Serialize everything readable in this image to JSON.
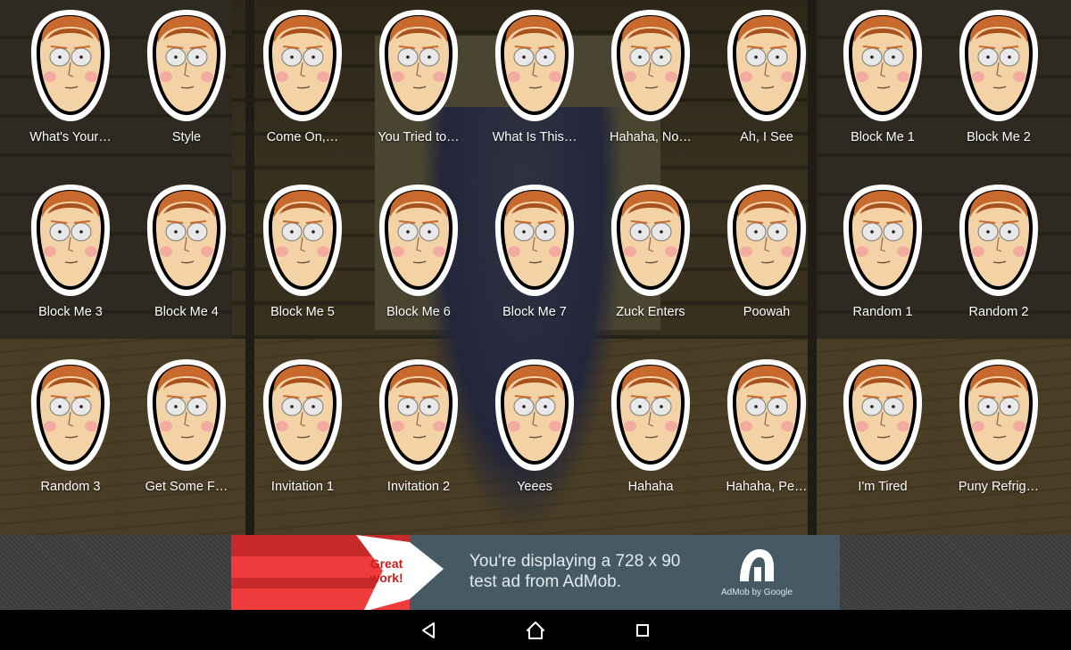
{
  "sounds": [
    "What's Your…",
    "Style",
    "Come On,…",
    "You Tried to…",
    "What Is This…",
    "Hahaha, No…",
    "Ah, I See",
    "Block Me 1",
    "Block Me 2",
    "Block Me 3",
    "Block Me 4",
    "Block Me 5",
    "Block Me 6",
    "Block Me 7",
    "Zuck Enters",
    "Poowah",
    "Random 1",
    "Random 2",
    "Random 3",
    "Get Some F…",
    "Invitation 1",
    "Invitation 2",
    "Yeees",
    "Hahaha",
    "Hahaha, Pe…",
    "I'm Tired",
    "Puny Refrig…"
  ],
  "ad": {
    "badge": "Great work!",
    "message": "You're displaying a 728 x 90 test ad from AdMob.",
    "brand": "AdMob by Google"
  },
  "navbar": {
    "back_icon": "back-triangle-icon",
    "home_icon": "home-icon",
    "recents_icon": "recents-square-icon"
  },
  "colors": {
    "label_text": "#ffffff",
    "ad_background": "#465a66",
    "navbar_background": "#000000"
  }
}
